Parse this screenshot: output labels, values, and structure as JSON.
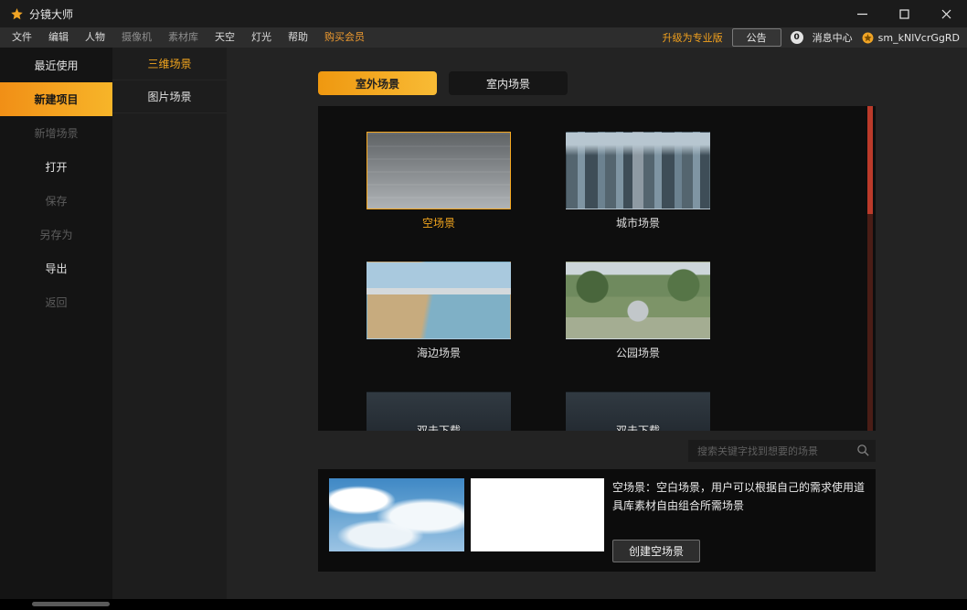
{
  "window": {
    "title": "分镜大师"
  },
  "menubar": {
    "items": [
      {
        "label": "文件",
        "state": "normal"
      },
      {
        "label": "编辑",
        "state": "normal"
      },
      {
        "label": "人物",
        "state": "normal"
      },
      {
        "label": "摄像机",
        "state": "dim"
      },
      {
        "label": "素材库",
        "state": "dim"
      },
      {
        "label": "天空",
        "state": "normal"
      },
      {
        "label": "灯光",
        "state": "normal"
      },
      {
        "label": "帮助",
        "state": "normal"
      },
      {
        "label": "购买会员",
        "state": "highlight"
      }
    ],
    "upgrade": "升级为专业版",
    "announcement": "公告",
    "badge_count": "0",
    "message_center": "消息中心",
    "username": "sm_kNlVcrGgRD"
  },
  "sidebar": {
    "items": [
      {
        "label": "最近使用",
        "state": "normal"
      },
      {
        "label": "新建项目",
        "state": "active"
      },
      {
        "label": "新增场景",
        "state": "disabled"
      },
      {
        "label": "打开",
        "state": "normal"
      },
      {
        "label": "保存",
        "state": "disabled"
      },
      {
        "label": "另存为",
        "state": "disabled"
      },
      {
        "label": "导出",
        "state": "normal"
      },
      {
        "label": "返回",
        "state": "disabled"
      }
    ]
  },
  "subsidebar": {
    "items": [
      {
        "label": "三维场景",
        "active": true
      },
      {
        "label": "图片场景",
        "active": false
      }
    ]
  },
  "tabs": [
    {
      "label": "室外场景",
      "active": true
    },
    {
      "label": "室内场景",
      "active": false
    }
  ],
  "scenes": [
    {
      "name": "空场景",
      "selected": true,
      "thumb": "empty"
    },
    {
      "name": "城市场景",
      "selected": false,
      "thumb": "city"
    },
    {
      "name": "海边场景",
      "selected": false,
      "thumb": "beach"
    },
    {
      "name": "公园场景",
      "selected": false,
      "thumb": "park"
    },
    {
      "name": "双击下载",
      "selected": false,
      "thumb": "download"
    },
    {
      "name": "双击下载",
      "selected": false,
      "thumb": "download"
    }
  ],
  "search": {
    "placeholder": "搜索关键字找到想要的场景"
  },
  "detail": {
    "description": "空场景：空白场景，用户可以根据自己的需求使用道具库素材自由组合所需场景",
    "create_button": "创建空场景"
  },
  "colors": {
    "accent": "#f2a51e",
    "scrollbar_thumb": "#bb3a2a"
  },
  "icons": {
    "logo": "orange-star",
    "minimize": "minimize-dash",
    "maximize": "maximize-square",
    "close": "close-x",
    "search": "magnifier",
    "user": "orange-avatar-star"
  }
}
